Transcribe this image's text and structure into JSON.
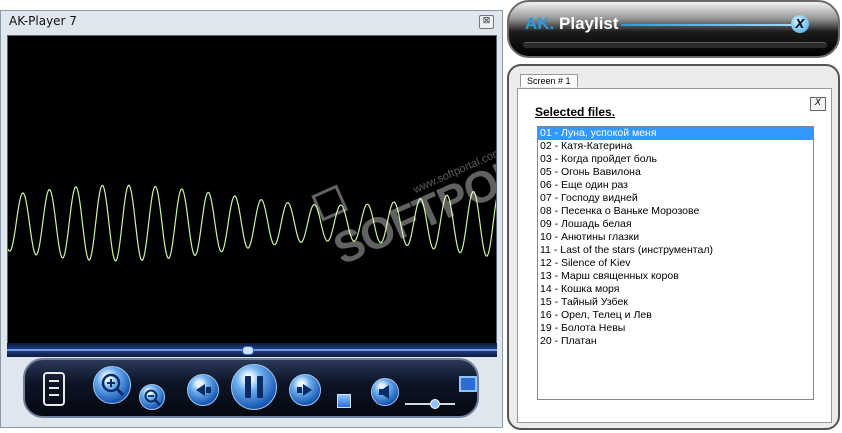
{
  "player": {
    "title": "AK-Player 7",
    "close_label": "⊠",
    "watermark_text": "SOFTPORTAL",
    "watermark_url": "www.softportal.com",
    "seek_position": 0.49,
    "volume_level": 0.6
  },
  "playlist": {
    "logo_ak": "AK.",
    "logo_title": "Playlist",
    "close_label": "X",
    "tab_label": "Screen # 1",
    "panel_close_label": "X",
    "selected_title": "Selected files.",
    "selected_index": 0,
    "items": [
      "01 - Луна, успокой меня",
      "02 - Катя-Катерина",
      "03 - Когда пройдет боль",
      "05 - Огонь Вавилона",
      "06 - Еще один раз",
      "07 - Господу видней",
      "08 - Песенка о Ваньке Морозове",
      "09 - Лошадь белая",
      "10 - Анютины глазки",
      "11 - Last of the stars (инструментал)",
      "12 - Silence of Kiev",
      "13 - Марш священных коров",
      "14 - Кошка моря",
      "15 - Тайный Узбек",
      "16 - Орел, Телец и Лев",
      "19 - Болота Невы",
      "20 - Платан"
    ]
  },
  "colors": {
    "wave": "#c8f5a0",
    "accent": "#2a9ad8",
    "selection": "#3399ff"
  }
}
